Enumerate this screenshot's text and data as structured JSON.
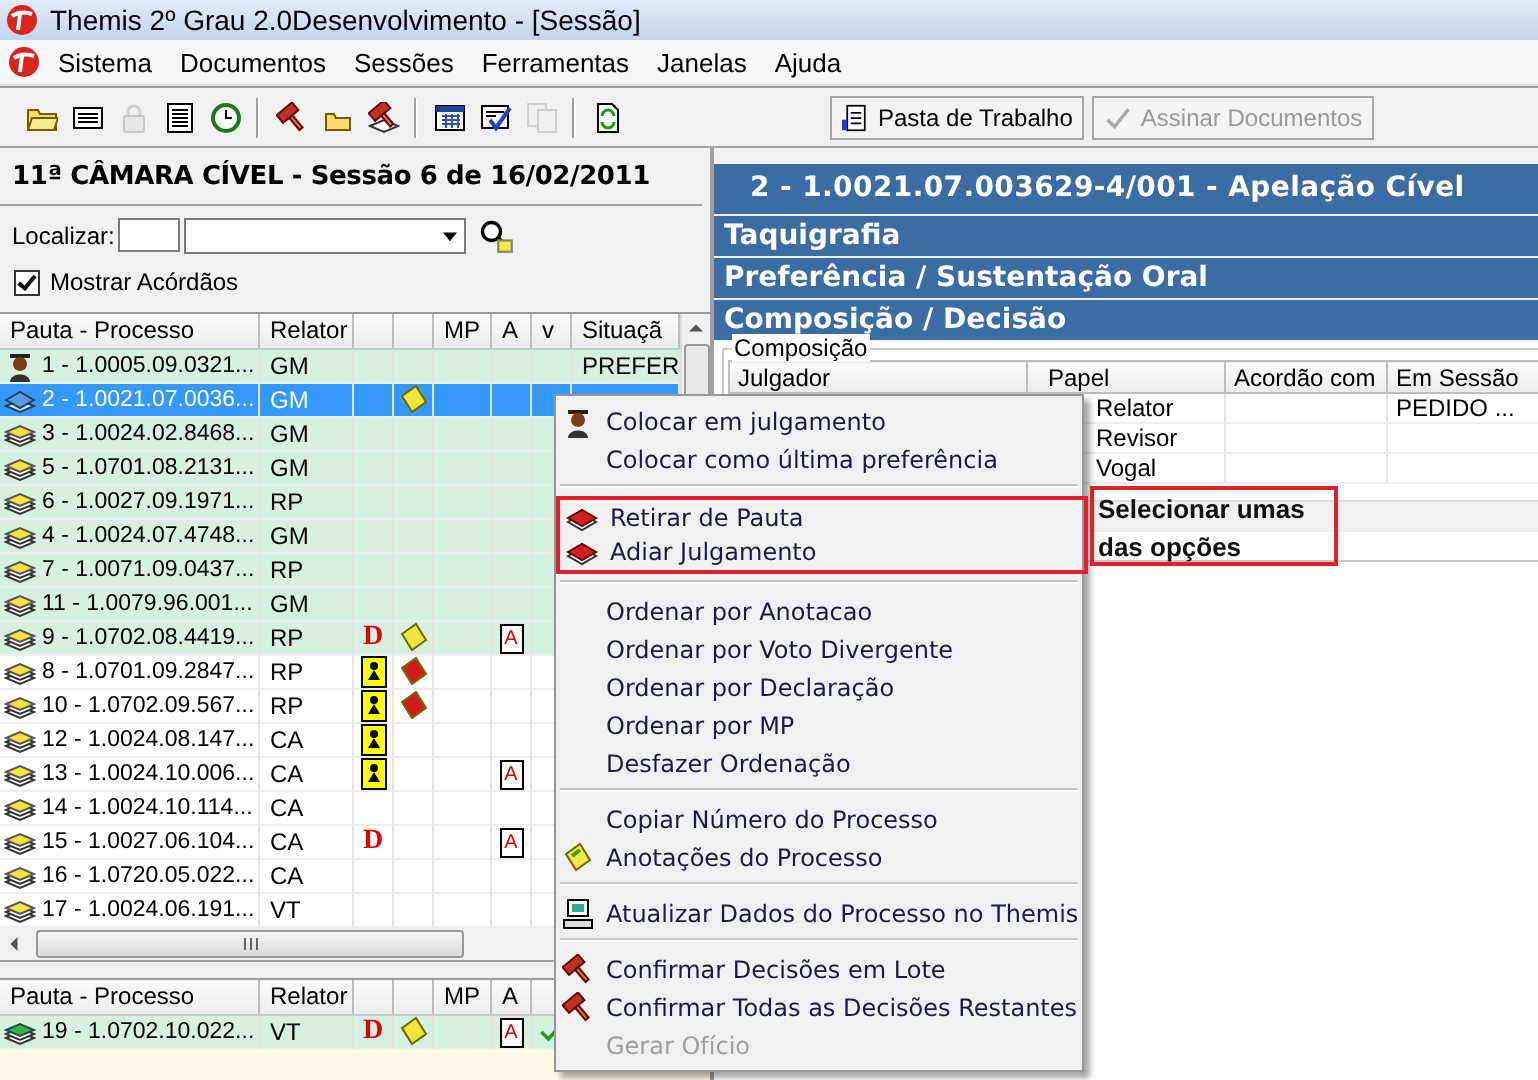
{
  "window": {
    "title": "Themis 2º Grau 2.0Desenvolvimento - [Sessão]"
  },
  "menu": [
    "Sistema",
    "Documentos",
    "Sessões",
    "Ferramentas",
    "Janelas",
    "Ajuda"
  ],
  "toolbar": [
    {
      "kind": "folder",
      "disabled": false
    },
    {
      "kind": "card",
      "disabled": false
    },
    {
      "kind": "lock",
      "disabled": true
    },
    {
      "kind": "list",
      "disabled": false
    },
    {
      "kind": "clock",
      "disabled": false
    },
    {
      "kind": "separator"
    },
    {
      "kind": "gavel",
      "disabled": false
    },
    {
      "kind": "smallfolder",
      "disabled": false
    },
    {
      "kind": "gavels",
      "disabled": false
    },
    {
      "kind": "separator"
    },
    {
      "kind": "calendar",
      "disabled": false
    },
    {
      "kind": "checklist",
      "disabled": false
    },
    {
      "kind": "copy",
      "disabled": true
    },
    {
      "kind": "separator"
    },
    {
      "kind": "refresh",
      "disabled": false
    }
  ],
  "toolbar_buttons": [
    {
      "label": "Pasta de Trabalho",
      "disabled": false
    },
    {
      "label": "Assinar Documentos",
      "disabled": true
    }
  ],
  "session": {
    "title": "11ª  CÂMARA CÍVEL - Sessão 6 de 16/02/2011",
    "search_label": "Localizar:",
    "show_judgments": {
      "label": "Mostrar Acórdãos",
      "checked": true
    },
    "columns": [
      {
        "kind": "process",
        "label": "Pauta - Processo"
      },
      {
        "kind": "judge",
        "label": "Relator"
      },
      {
        "kind": "mp",
        "label": "MP"
      },
      {
        "kind": "annotation",
        "label": "A"
      },
      {
        "kind": "voted",
        "label": "v"
      },
      {
        "kind": "situation",
        "label": "Situaçã"
      }
    ],
    "rows": [
      {
        "process": "1 - 1.0005.09.0321...",
        "judge": "GM",
        "kind": "judge",
        "situation": "PREFER",
        "preference": true,
        "selected": false,
        "declaration": false
      },
      {
        "process": "2 - 1.0021.07.0036...",
        "judge": "GM",
        "kind": "current",
        "note": {
          "color": "#f2e43a"
        },
        "preference": true,
        "selected": true,
        "declaration": false
      },
      {
        "process": "3 - 1.0024.02.8468...",
        "judge": "GM",
        "kind": "pending",
        "preference": true,
        "selected": false,
        "declaration": false
      },
      {
        "process": "5 - 1.0701.08.2131...",
        "judge": "GM",
        "kind": "pending",
        "preference": true,
        "selected": false,
        "declaration": false
      },
      {
        "process": "6 - 1.0027.09.1971...",
        "judge": "RP",
        "kind": "pending",
        "preference": true,
        "selected": false,
        "declaration": false
      },
      {
        "process": "4 - 1.0024.07.4748...",
        "judge": "GM",
        "kind": "pending",
        "preference": true,
        "selected": false,
        "declaration": false
      },
      {
        "process": "7 - 1.0071.09.0437...",
        "judge": "RP",
        "kind": "pending",
        "preference": true,
        "selected": false,
        "declaration": false
      },
      {
        "process": "11 - 1.0079.96.001...",
        "judge": "GM",
        "kind": "pending",
        "preference": true,
        "selected": false,
        "declaration": false
      },
      {
        "process": "9 - 1.0702.08.4419...",
        "judge": "RP",
        "kind": "pending",
        "divergent": "D",
        "note": {
          "color": "#f2e43a"
        },
        "annotation": "A",
        "preference": true,
        "selected": false,
        "declaration": false
      },
      {
        "process": "8 - 1.0701.09.2847...",
        "judge": "RP",
        "kind": "pending",
        "note": {
          "color": "#d41b1b"
        },
        "preference": false,
        "selected": false,
        "declaration": true
      },
      {
        "process": "10 - 1.0702.09.567...",
        "judge": "RP",
        "kind": "pending",
        "note": {
          "color": "#d41b1b"
        },
        "preference": false,
        "selected": false,
        "declaration": true
      },
      {
        "process": "12 - 1.0024.08.147...",
        "judge": "CA",
        "kind": "pending",
        "preference": false,
        "selected": false,
        "declaration": true
      },
      {
        "process": "13 - 1.0024.10.006...",
        "judge": "CA",
        "kind": "pending",
        "annotation": "A",
        "preference": false,
        "selected": false,
        "declaration": true
      },
      {
        "process": "14 - 1.0024.10.114...",
        "judge": "CA",
        "kind": "pending",
        "preference": false,
        "selected": false,
        "declaration": false
      },
      {
        "process": "15 - 1.0027.06.104...",
        "judge": "CA",
        "kind": "pending",
        "divergent": "D",
        "annotation": "A",
        "preference": false,
        "selected": false,
        "declaration": false
      },
      {
        "process": "16 - 1.0720.05.022...",
        "judge": "CA",
        "kind": "pending",
        "preference": false,
        "selected": false,
        "declaration": false
      },
      {
        "process": "17 - 1.0024.06.191...",
        "judge": "VT",
        "kind": "pending",
        "preference": false,
        "selected": false,
        "declaration": false
      }
    ]
  },
  "judged": {
    "columns": [
      {
        "kind": "process",
        "label": "Pauta - Processo"
      },
      {
        "kind": "judge",
        "label": "Relator"
      },
      {
        "kind": "mp",
        "label": "MP"
      },
      {
        "kind": "annotation",
        "label": "A"
      }
    ],
    "rows": [
      {
        "process": "19 - 1.0702.10.022...",
        "judge": "VT",
        "kind": "judged",
        "divergent": "D",
        "note": {
          "color": "#f2e43a"
        },
        "annotation": "A",
        "voted": true,
        "preference": true,
        "selected": false,
        "declaration": false
      }
    ]
  },
  "process": {
    "title": "2  -  1.0021.07.003629-4/001 - Apelação Cível",
    "sections": [
      "Taquigrafia",
      "Preferência / Sustentação Oral",
      "Composição / Decisão"
    ],
    "group_label": "Composição",
    "columns": [
      "Julgador",
      "Papel",
      "Acordão com",
      "Em Sessão"
    ],
    "rows": [
      {
        "role": "Relator",
        "in_session": "PEDIDO ..."
      },
      {
        "role": "Revisor"
      },
      {
        "role": "Vogal"
      }
    ]
  },
  "context_menu": {
    "items": [
      {
        "kind": "judge",
        "label": "Colocar em julgamento",
        "disabled": false,
        "marked": false
      },
      {
        "kind": "item",
        "label": "Colocar como última preferência",
        "disabled": false,
        "marked": false
      },
      {
        "kind": "separator"
      },
      {
        "kind": "book",
        "label": "Retirar de Pauta",
        "disabled": false,
        "marked": true
      },
      {
        "kind": "book",
        "label": "Adiar Julgamento",
        "disabled": false,
        "marked": true
      },
      {
        "kind": "separator"
      },
      {
        "kind": "item",
        "label": "Ordenar por Anotacao",
        "disabled": false,
        "marked": false
      },
      {
        "kind": "item",
        "label": "Ordenar por Voto Divergente",
        "disabled": false,
        "marked": false
      },
      {
        "kind": "item",
        "label": "Ordenar por Declaração",
        "disabled": false,
        "marked": false
      },
      {
        "kind": "item",
        "label": "Ordenar por MP",
        "disabled": false,
        "marked": false
      },
      {
        "kind": "item",
        "label": "Desfazer Ordenação",
        "disabled": false,
        "marked": false
      },
      {
        "kind": "separator"
      },
      {
        "kind": "item",
        "label": "Copiar Número do Processo",
        "disabled": false,
        "marked": false
      },
      {
        "kind": "note",
        "label": "Anotações do Processo",
        "disabled": false,
        "marked": false
      },
      {
        "kind": "separator"
      },
      {
        "kind": "computer",
        "label": "Atualizar Dados do Processo no Themis",
        "disabled": false,
        "marked": false
      },
      {
        "kind": "separator"
      },
      {
        "kind": "gavel",
        "label": "Confirmar Decisões em Lote",
        "disabled": false,
        "marked": false
      },
      {
        "kind": "gavel",
        "label": "Confirmar Todas as Decisões Restantes",
        "disabled": false,
        "marked": false
      },
      {
        "kind": "item",
        "label": "Gerar Ofício",
        "disabled": true,
        "marked": false
      }
    ]
  },
  "callout": {
    "text": "Selecionar umas das opções"
  }
}
